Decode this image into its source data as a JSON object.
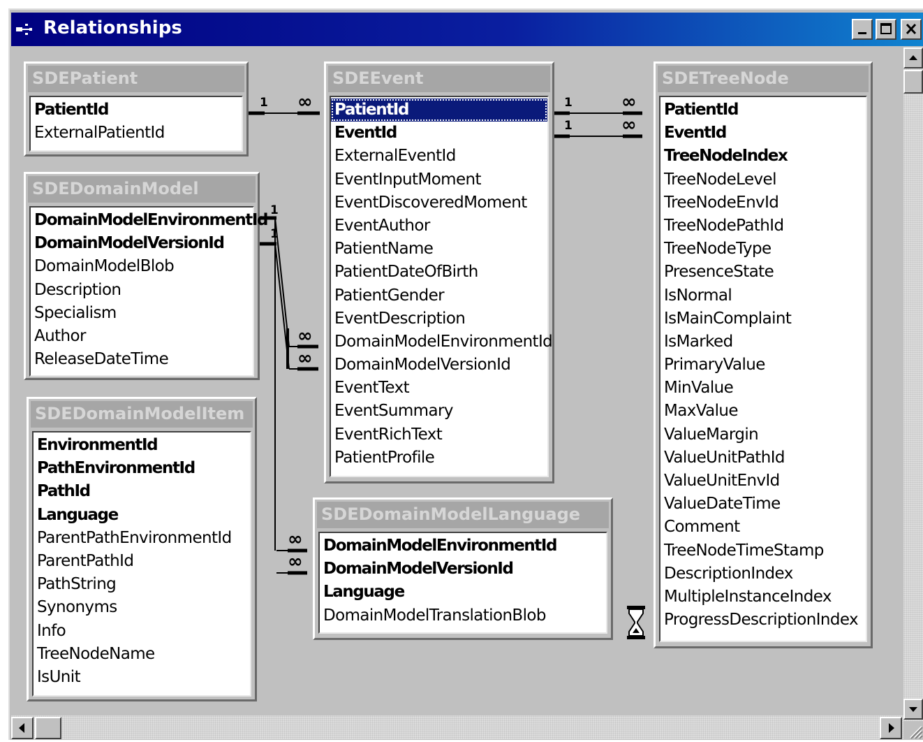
{
  "window": {
    "title": "Relationships"
  },
  "tables": {
    "patient": {
      "name": "SDEPatient",
      "fields": [
        {
          "name": "PatientId",
          "key": true
        },
        {
          "name": "ExternalPatientId",
          "key": false
        }
      ]
    },
    "event": {
      "name": "SDEEvent",
      "fields": [
        {
          "name": "PatientId",
          "key": true,
          "selected": true
        },
        {
          "name": "EventId",
          "key": true
        },
        {
          "name": "ExternalEventId"
        },
        {
          "name": "EventInputMoment"
        },
        {
          "name": "EventDiscoveredMoment"
        },
        {
          "name": "EventAuthor"
        },
        {
          "name": "PatientName"
        },
        {
          "name": "PatientDateOfBirth"
        },
        {
          "name": "PatientGender"
        },
        {
          "name": "EventDescription"
        },
        {
          "name": "DomainModelEnvironmentId"
        },
        {
          "name": "DomainModelVersionId"
        },
        {
          "name": "EventText"
        },
        {
          "name": "EventSummary"
        },
        {
          "name": "EventRichText"
        },
        {
          "name": "PatientProfile"
        }
      ]
    },
    "treenode": {
      "name": "SDETreeNode",
      "fields": [
        {
          "name": "PatientId",
          "key": true
        },
        {
          "name": "EventId",
          "key": true
        },
        {
          "name": "TreeNodeIndex",
          "key": true
        },
        {
          "name": "TreeNodeLevel"
        },
        {
          "name": "TreeNodeEnvId"
        },
        {
          "name": "TreeNodePathId"
        },
        {
          "name": "TreeNodeType"
        },
        {
          "name": "PresenceState"
        },
        {
          "name": "IsNormal"
        },
        {
          "name": "IsMainComplaint"
        },
        {
          "name": "IsMarked"
        },
        {
          "name": "PrimaryValue"
        },
        {
          "name": "MinValue"
        },
        {
          "name": "MaxValue"
        },
        {
          "name": "ValueMargin"
        },
        {
          "name": "ValueUnitPathId"
        },
        {
          "name": "ValueUnitEnvId"
        },
        {
          "name": "ValueDateTime"
        },
        {
          "name": "Comment"
        },
        {
          "name": "TreeNodeTimeStamp"
        },
        {
          "name": "DescriptionIndex"
        },
        {
          "name": "MultipleInstanceIndex"
        },
        {
          "name": "ProgressDescriptionIndex"
        }
      ]
    },
    "domainmodel": {
      "name": "SDEDomainModel",
      "fields": [
        {
          "name": "DomainModelEnvironmentId",
          "key": true
        },
        {
          "name": "DomainModelVersionId",
          "key": true
        },
        {
          "name": "DomainModelBlob"
        },
        {
          "name": "Description"
        },
        {
          "name": "Specialism"
        },
        {
          "name": "Author"
        },
        {
          "name": "ReleaseDateTime"
        }
      ]
    },
    "domainmodelitem": {
      "name": "SDEDomainModelItem",
      "fields": [
        {
          "name": "EnvironmentId",
          "key": true
        },
        {
          "name": "PathEnvironmentId",
          "key": true
        },
        {
          "name": "PathId",
          "key": true
        },
        {
          "name": "Language",
          "key": true
        },
        {
          "name": "ParentPathEnvironmentId"
        },
        {
          "name": "ParentPathId"
        },
        {
          "name": "PathString"
        },
        {
          "name": "Synonyms"
        },
        {
          "name": "Info"
        },
        {
          "name": "TreeNodeName"
        },
        {
          "name": "IsUnit"
        }
      ]
    },
    "domainmodellanguage": {
      "name": "SDEDomainModelLanguage",
      "fields": [
        {
          "name": "DomainModelEnvironmentId",
          "key": true
        },
        {
          "name": "DomainModelVersionId",
          "key": true
        },
        {
          "name": "Language",
          "key": true
        },
        {
          "name": "DomainModelTranslationBlob"
        }
      ]
    }
  },
  "relationships": {
    "one": "1",
    "many": "∞"
  },
  "icons": {
    "system": "relationships-icon",
    "minimize": "minimize-icon",
    "maximize": "maximize-icon",
    "close": "close-icon",
    "busy": "hourglass-icon"
  }
}
